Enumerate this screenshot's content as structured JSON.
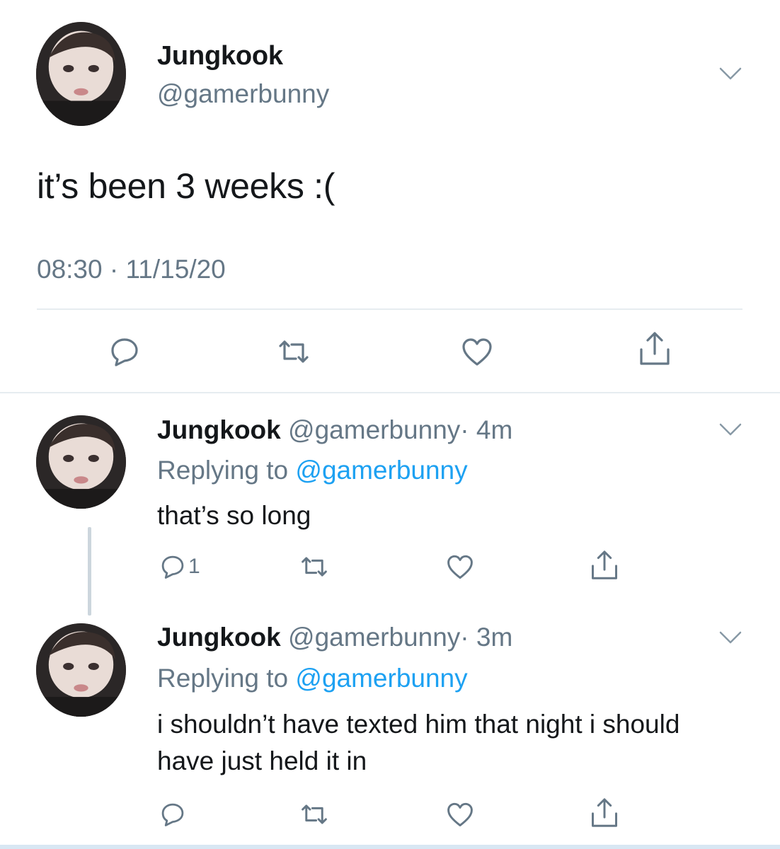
{
  "main_tweet": {
    "name": "Jungkook",
    "handle": "@gamerbunny",
    "text": "it’s been 3 weeks :(",
    "timestamp": "08:30 · 11/15/20",
    "actions": [
      "reply-icon",
      "retweet-icon",
      "like-icon",
      "share-icon"
    ]
  },
  "replies": [
    {
      "name": "Jungkook",
      "handle": "@gamerbunny",
      "time": "· 4m",
      "replying_label": "Replying to",
      "replying_to": "@gamerbunny",
      "text": "that’s so long",
      "reply_count": "1"
    },
    {
      "name": "Jungkook",
      "handle": "@gamerbunny",
      "time": "· 3m",
      "replying_label": "Replying to",
      "replying_to": "@gamerbunny",
      "text": "i shouldn’t have texted him that night i should have just held it in",
      "reply_count": ""
    }
  ],
  "colors": {
    "text": "#14171a",
    "secondary": "#657786",
    "link": "#1da1f2",
    "divider": "#e6ecf0"
  }
}
